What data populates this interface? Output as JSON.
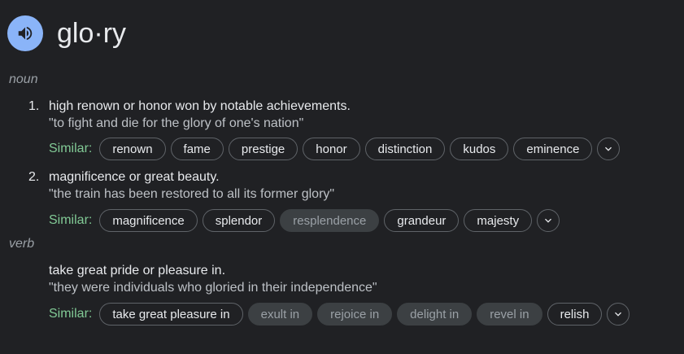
{
  "word": "glo·ry",
  "entries": [
    {
      "pos": "noun",
      "senses": [
        {
          "number": "1.",
          "definition": "high renown or honor won by notable achievements.",
          "example": "\"to fight and die for the glory of one's nation\"",
          "similar_label": "Similar:",
          "similar": [
            {
              "text": "renown",
              "muted": false
            },
            {
              "text": "fame",
              "muted": false
            },
            {
              "text": "prestige",
              "muted": false
            },
            {
              "text": "honor",
              "muted": false
            },
            {
              "text": "distinction",
              "muted": false
            },
            {
              "text": "kudos",
              "muted": false
            },
            {
              "text": "eminence",
              "muted": false
            }
          ]
        },
        {
          "number": "2.",
          "definition": "magnificence or great beauty.",
          "example": "\"the train has been restored to all its former glory\"",
          "similar_label": "Similar:",
          "similar": [
            {
              "text": "magnificence",
              "muted": false
            },
            {
              "text": "splendor",
              "muted": false
            },
            {
              "text": "resplendence",
              "muted": true
            },
            {
              "text": "grandeur",
              "muted": false
            },
            {
              "text": "majesty",
              "muted": false
            }
          ]
        }
      ]
    },
    {
      "pos": "verb",
      "senses": [
        {
          "number": "",
          "definition": "take great pride or pleasure in.",
          "example": "\"they were individuals who gloried in their independence\"",
          "similar_label": "Similar:",
          "similar": [
            {
              "text": "take great pleasure in",
              "muted": false
            },
            {
              "text": "exult in",
              "muted": true
            },
            {
              "text": "rejoice in",
              "muted": true
            },
            {
              "text": "delight in",
              "muted": true
            },
            {
              "text": "revel in",
              "muted": true
            },
            {
              "text": "relish",
              "muted": false
            }
          ]
        }
      ]
    }
  ],
  "icons": {
    "audio": "speaker-icon",
    "expand": "chevron-down-icon"
  },
  "colors": {
    "accent": "#8ab4f8",
    "similar_label": "#81c995",
    "background": "#202124"
  }
}
